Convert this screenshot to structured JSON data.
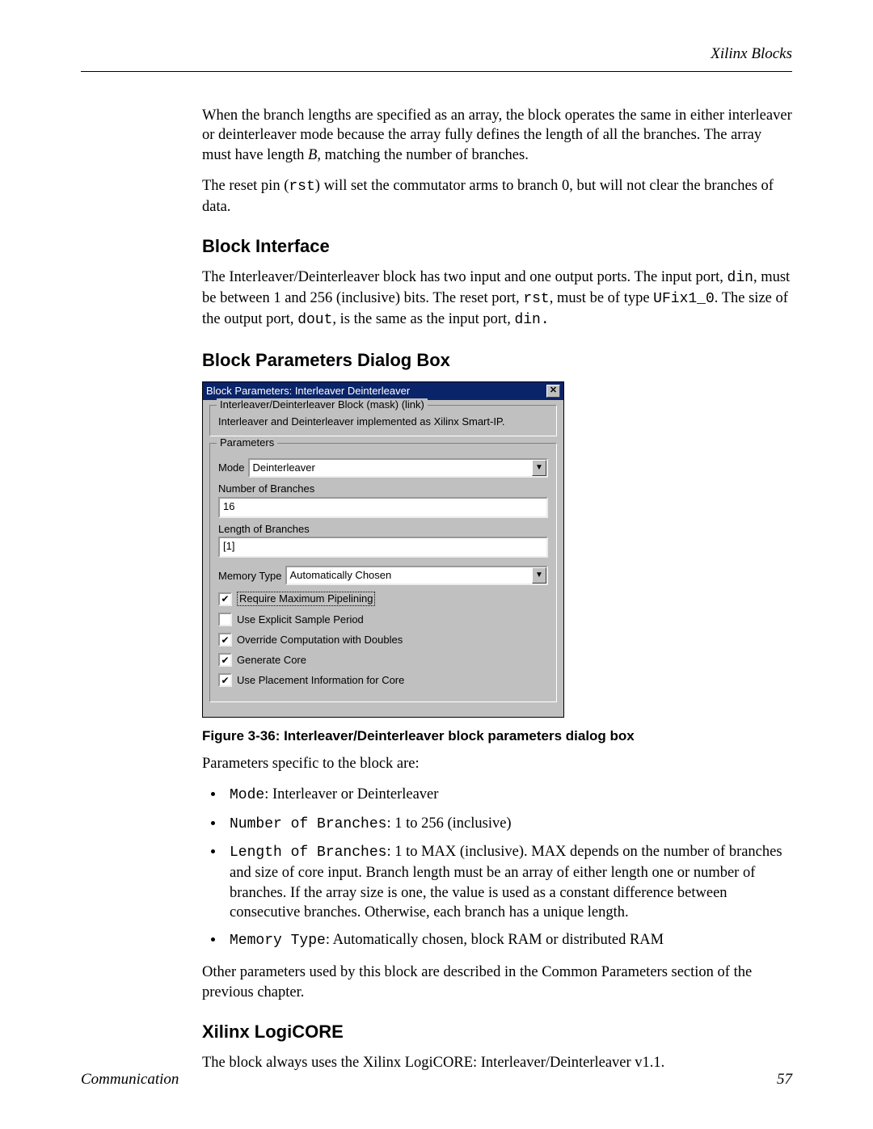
{
  "header": {
    "title": "Xilinx Blocks"
  },
  "body": {
    "p1": "When the branch lengths are specified as an array, the block operates the same in either interleaver or deinterleaver mode because the array fully defines the length of all the branches.  The array must have length ",
    "p1_i": "B",
    "p1b": ", matching the number of branches.",
    "p2a": "The reset pin (",
    "p2_code1": "rst",
    "p2b": ") will set the commutator arms to branch 0, but will not clear the branches of data.",
    "h_iface": "Block Interface",
    "p3a": "The Interleaver/Deinterleaver block has two input and one output ports.  The input port, ",
    "p3_c1": "din",
    "p3b": ", must be between 1 and 256 (inclusive) bits.  The reset port, ",
    "p3_c2": "rst",
    "p3c": ", must be of type ",
    "p3_c3": "UFix1_0",
    "p3d": ".  The size of the output port, ",
    "p3_c4": "dout",
    "p3e": ", is the same as the input port, ",
    "p3_c5": "din.",
    "h_params": "Block Parameters Dialog Box",
    "figcap": "Figure 3-36:   Interleaver/Deinterleaver block parameters dialog box",
    "p4": "Parameters specific to the block are:",
    "li1a": "Mode",
    "li1b": ": Interleaver or Deinterleaver",
    "li2a": "Number of Branches",
    "li2b": ": 1 to 256 (inclusive)",
    "li3a": "Length of Branches",
    "li3b": ": 1 to MAX (inclusive).  MAX depends on the number of branches and size of core input.  Branch length must be an array of either length one or number of branches.  If the array size is one, the value is used as a constant difference between consecutive branches.  Otherwise, each branch has a unique length.",
    "li4a": "Memory Type",
    "li4b": ": Automatically chosen, block RAM or distributed RAM",
    "p5": "Other parameters used by this block are described in the Common Parameters section of the previous chapter.",
    "h_core": "Xilinx LogiCORE",
    "p6": "The block always uses the Xilinx LogiCORE: Interleaver/Deinterleaver v1.1."
  },
  "dialog": {
    "title": "Block Parameters: Interleaver Deinterleaver",
    "grp1_label": "Interleaver/Deinterleaver Block (mask) (link)",
    "grp1_text": "Interleaver and Deinterleaver implemented as Xilinx Smart-IP.",
    "grp2_label": "Parameters",
    "mode_label": "Mode",
    "mode_value": "Deinterleaver",
    "nb_label": "Number of Branches",
    "nb_value": "16",
    "lb_label": "Length of Branches",
    "lb_value": "[1]",
    "mem_label": "Memory Type",
    "mem_value": "Automatically Chosen",
    "chk_pipe": "Require Maximum Pipelining",
    "chk_esp": "Use Explicit Sample Period",
    "chk_ocd": "Override Computation with Doubles",
    "chk_gc": "Generate Core",
    "chk_upi": "Use Placement Information for Core"
  },
  "footer": {
    "left": "Communication",
    "page": "57"
  }
}
